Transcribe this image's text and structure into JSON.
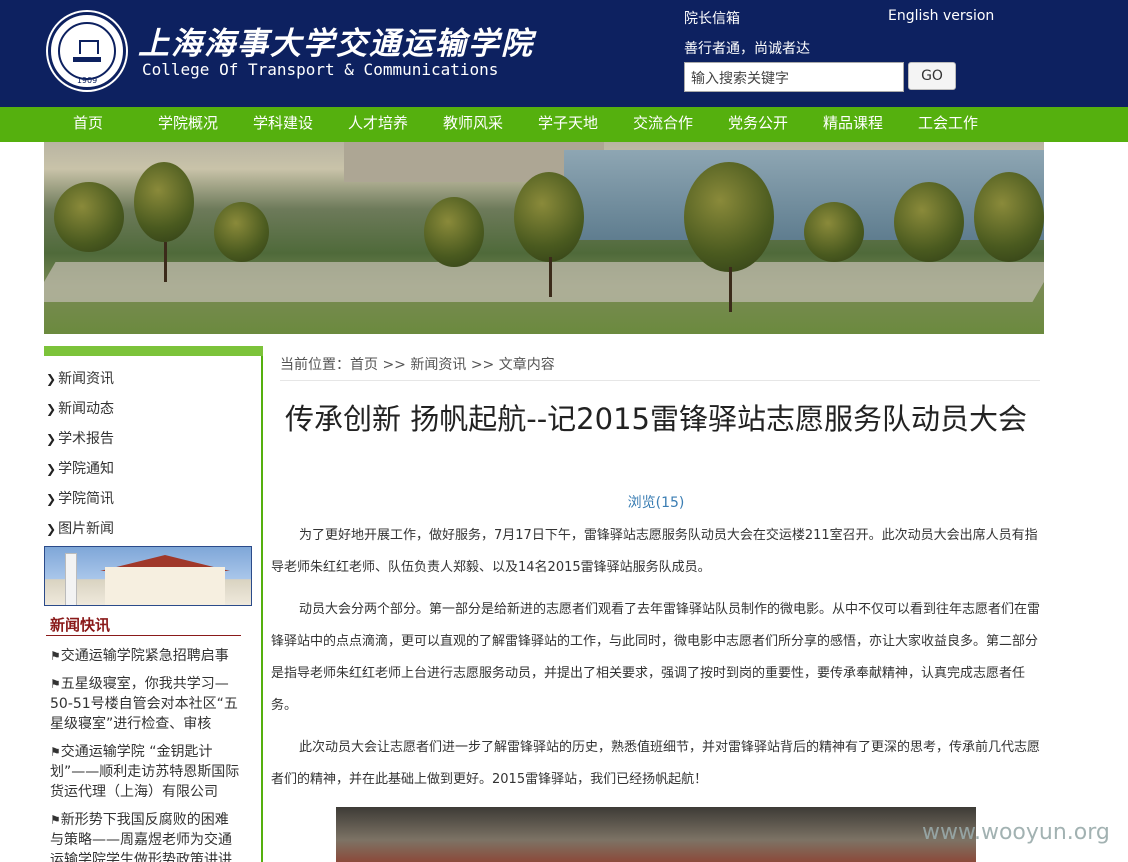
{
  "header": {
    "title_cn": "上海海事大学交通运输学院",
    "title_en": "College Of Transport & Communications",
    "logo_year": "1909",
    "dean_mailbox": "院长信箱",
    "english_version": "English version",
    "motto": "善行者通，尚诚者达",
    "search_placeholder": "输入搜索关键字",
    "go_label": "GO"
  },
  "nav": [
    "首页",
    "学院概况",
    "学科建设",
    "人才培养",
    "教师风采",
    "学子天地",
    "交流合作",
    "党务公开",
    "精品课程",
    "工会工作"
  ],
  "sidebar": {
    "items": [
      "新闻资讯",
      "新闻动态",
      "学术报告",
      "学院通知",
      "学院简讯",
      "图片新闻"
    ],
    "news_heading": "新闻快讯",
    "news": [
      "交通运输学院紧急招聘启事",
      "五星级寝室，你我共学习—50-51号楼自管会对本社区“五星级寝室”进行检查、审核",
      "交通运输学院 “金钥匙计划”——顺利走访苏特恩斯国际货运代理（上海）有限公司",
      "新形势下我国反腐败的困难与策略——周嘉煜老师为交通运输学院学生做形势政策讲讲"
    ]
  },
  "breadcrumb": {
    "label": "当前位置：",
    "home": "首页",
    "sep1": " >> ",
    "news": "新闻资讯",
    "sep2": " >> ",
    "article": "文章内容"
  },
  "article": {
    "title": "传承创新 扬帆起航--记2015雷锋驿站志愿服务队动员大会",
    "views": "浏览(15)",
    "paragraphs": [
      "为了更好地开展工作，做好服务，7月17日下午，雷锋驿站志愿服务队动员大会在交运楼211室召开。此次动员大会出席人员有指导老师朱红红老师、队伍负责人郑毅、以及14名2015雷锋驿站服务队成员。",
      "动员大会分两个部分。第一部分是给新进的志愿者们观看了去年雷锋驿站队员制作的微电影。从中不仅可以看到往年志愿者们在雷锋驿站中的点点滴滴，更可以直观的了解雷锋驿站的工作，与此同时，微电影中志愿者们所分享的感悟，亦让大家收益良多。第二部分是指导老师朱红红老师上台进行志愿服务动员，并提出了相关要求，强调了按时到岗的重要性，要传承奉献精神，认真完成志愿者任务。",
      "此次动员大会让志愿者们进一步了解雷锋驿站的历史，熟悉值班细节，并对雷锋驿站背后的精神有了更深的思考，传承前几代志愿者们的精神，并在此基础上做到更好。2015雷锋驿站，我们已经扬帆起航！"
    ]
  },
  "watermark": "www.wooyun.org"
}
